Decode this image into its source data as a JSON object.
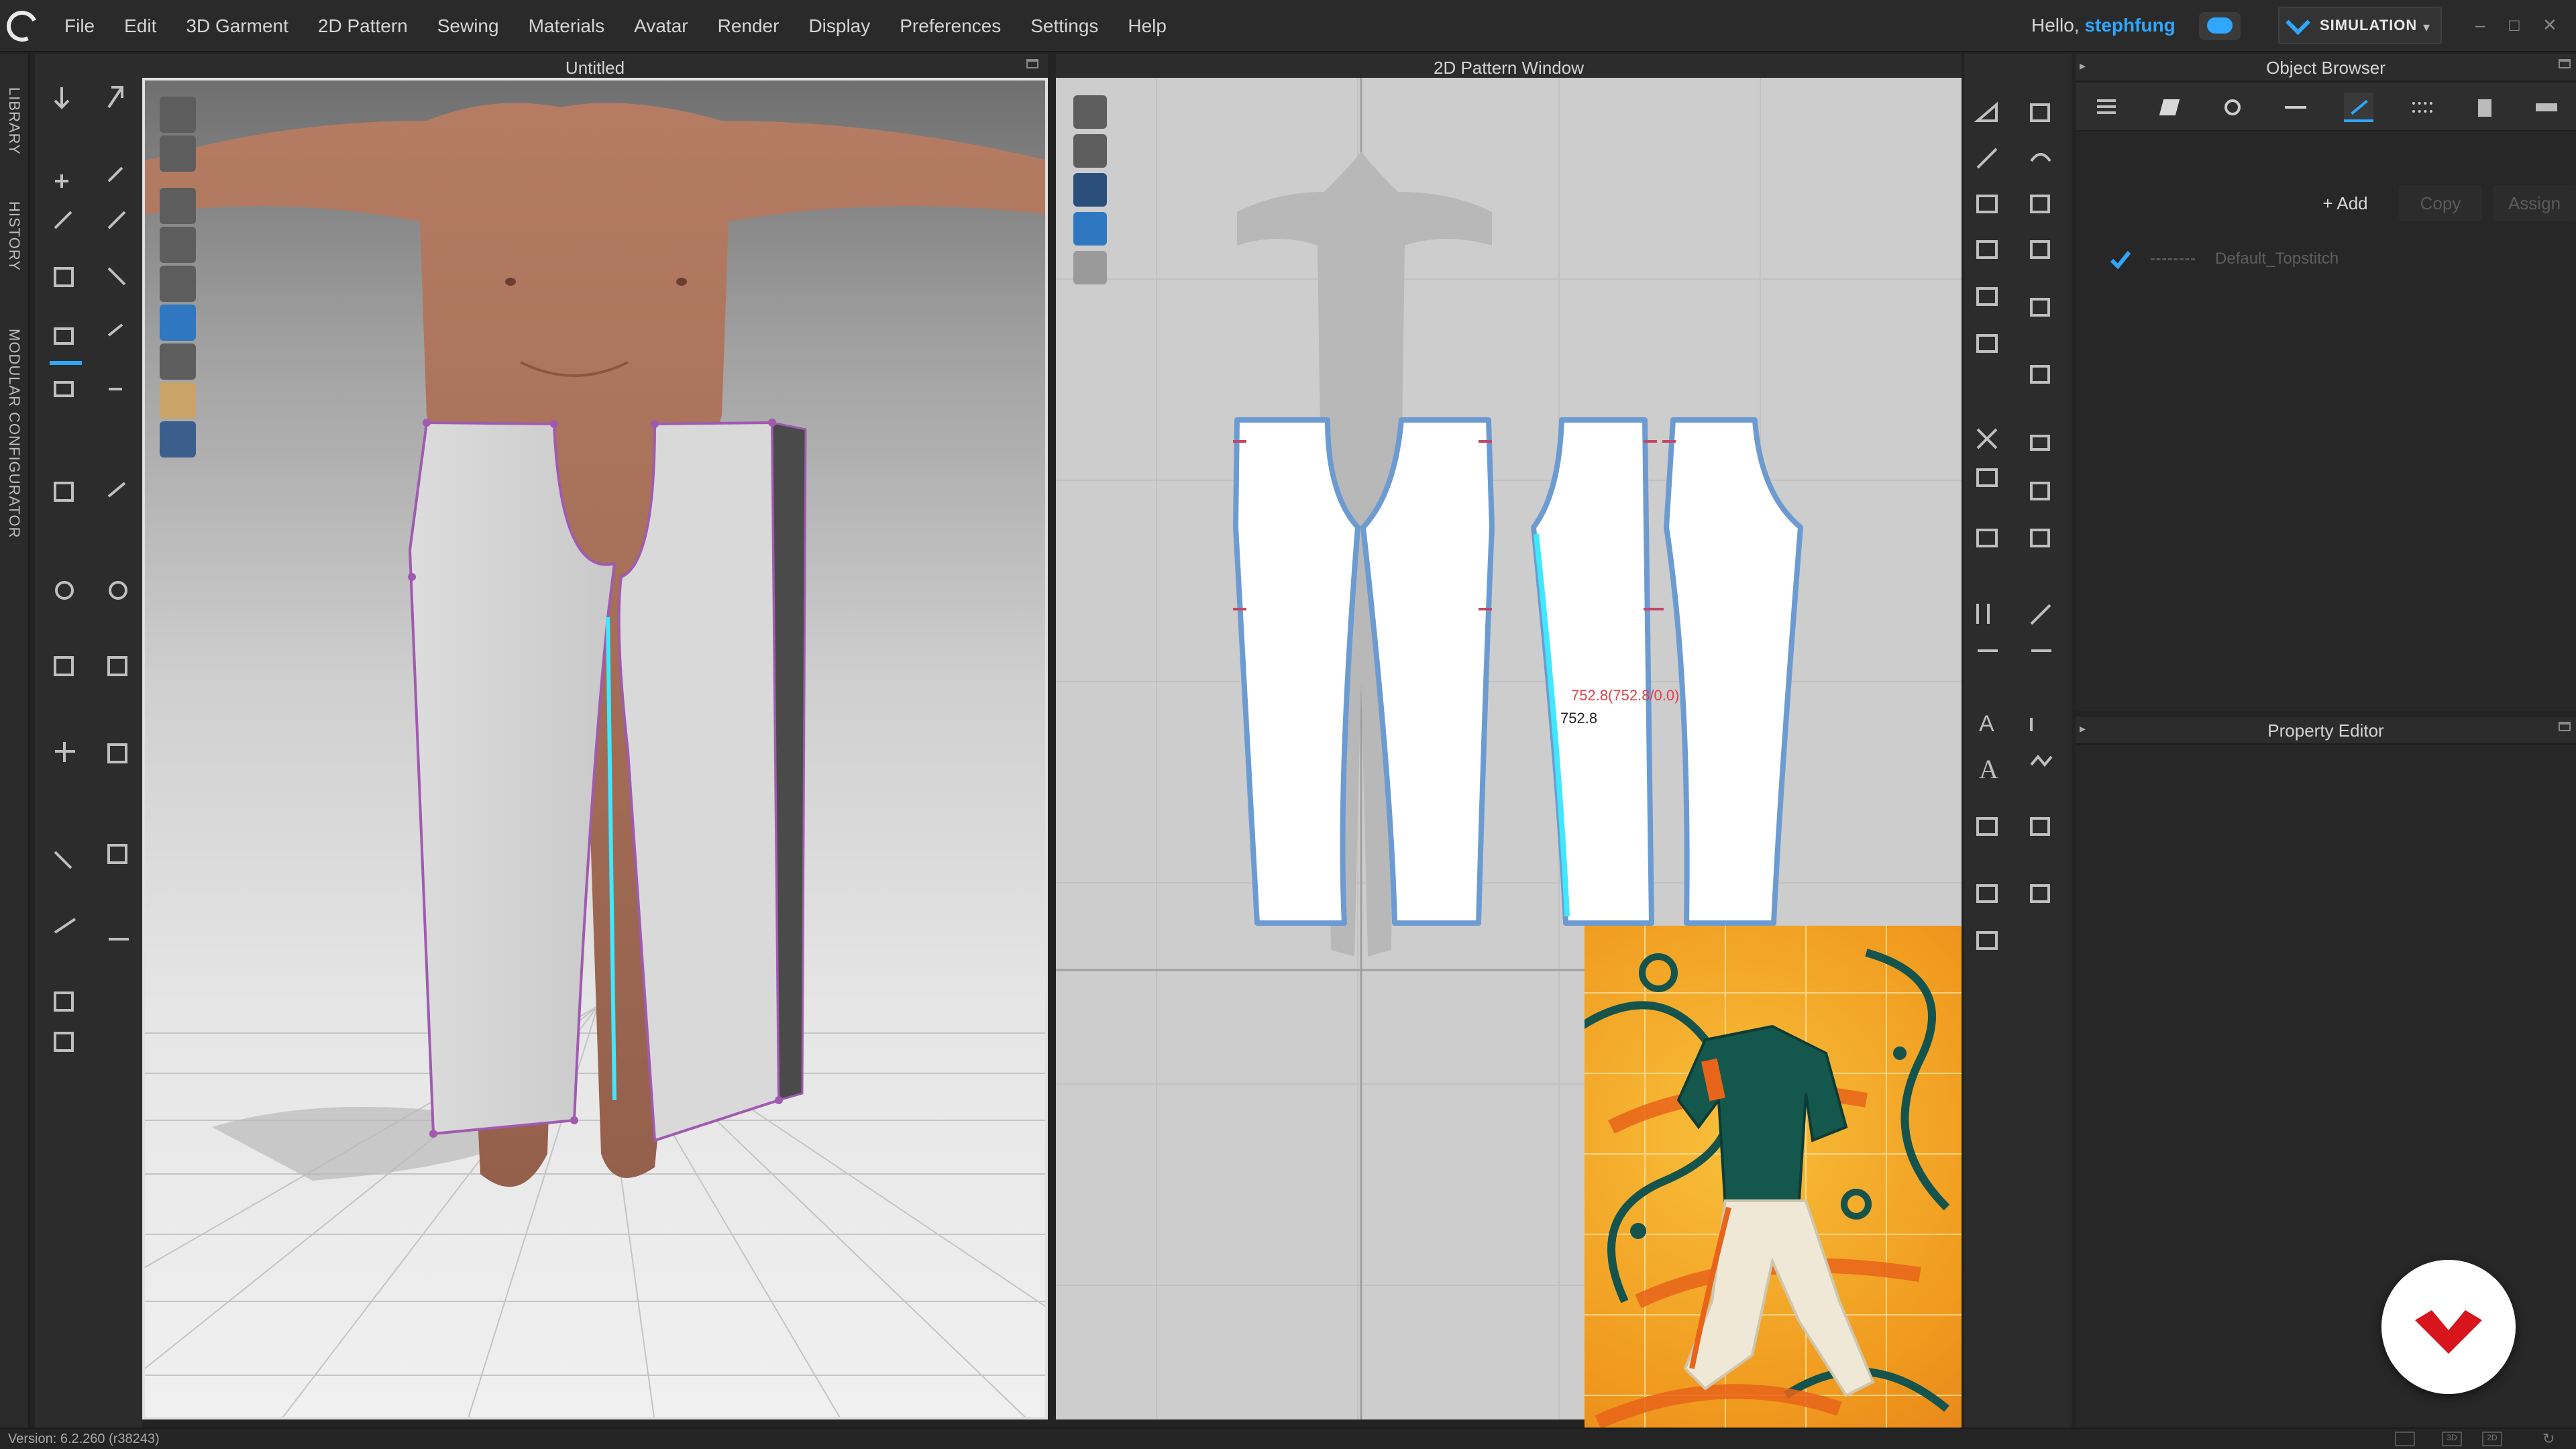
{
  "menubar": {
    "items": [
      "File",
      "Edit",
      "3D Garment",
      "2D Pattern",
      "Sewing",
      "Materials",
      "Avatar",
      "Render",
      "Display",
      "Preferences",
      "Settings",
      "Help"
    ],
    "greeting": "Hello, ",
    "username": "stephfung",
    "mode_label": "SIMULATION"
  },
  "side_tabs": [
    "LIBRARY",
    "HISTORY",
    "MODULAR CONFIGURATOR"
  ],
  "viewport_3d": {
    "title": "Untitled"
  },
  "pattern_window": {
    "title": "2D Pattern Window",
    "measure_primary": "752.8(752.8/0.0)",
    "measure_secondary": "752.8"
  },
  "object_browser": {
    "title": "Object Browser",
    "add_label": "Add",
    "copy_label": "Copy",
    "assign_label": "Assign",
    "items": [
      {
        "name": "Default_Topstitch",
        "checked": true
      }
    ]
  },
  "property_editor": {
    "title": "Property Editor"
  },
  "status": {
    "version": "Version: 6.2.260 (r38243)"
  },
  "colors": {
    "accent": "#2fa7ff",
    "pattern_outline": "#6c9bd1",
    "garment_outline": "#a05bb0",
    "measure_text": "#e0404a",
    "brand_badge": "#d8141c"
  }
}
